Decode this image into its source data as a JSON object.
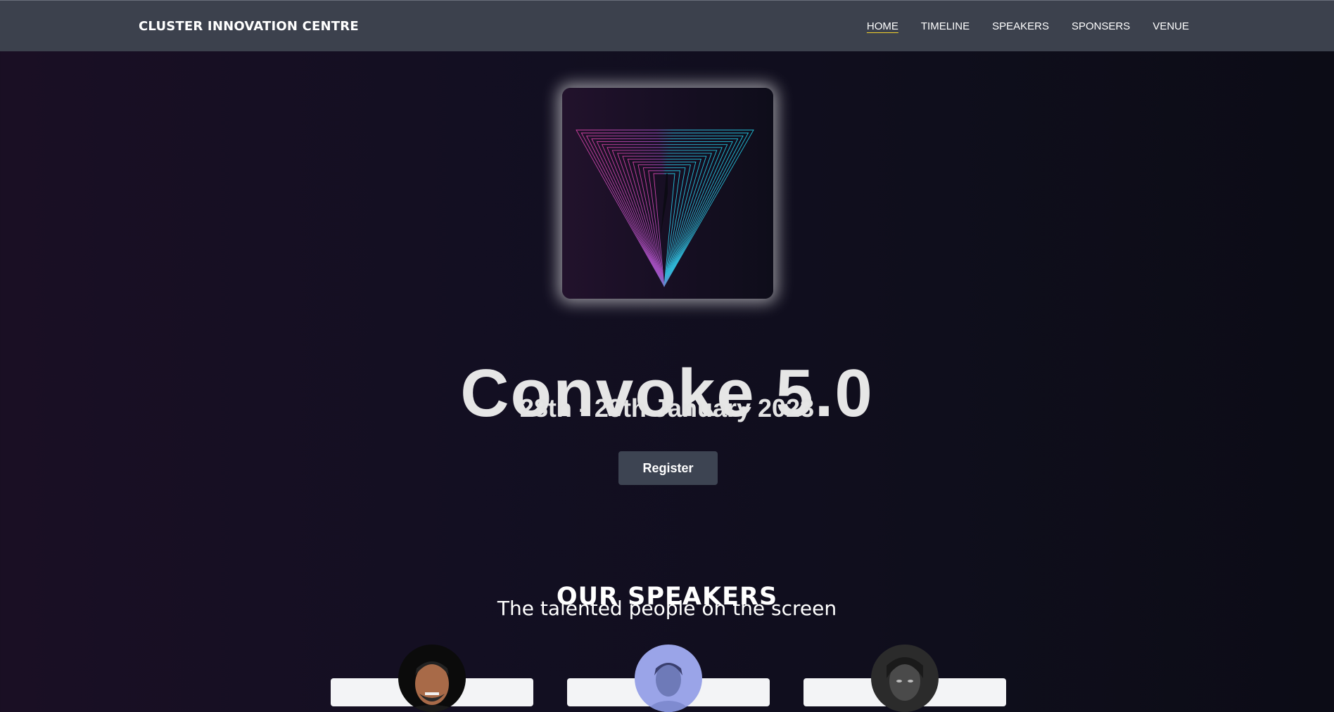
{
  "nav": {
    "brand": "CLUSTER INNOVATION CENTRE",
    "links": [
      "HOME",
      "TIMELINE",
      "SPEAKERS",
      "SPONSERS",
      "VENUE"
    ],
    "active": "HOME",
    "active_underline_color": "#f3d12a"
  },
  "hero": {
    "title": "Convoke 5.0",
    "date": "28th - 29th January 2023",
    "register_label": "Register"
  },
  "speakers": {
    "title": "OUR SPEAKERS",
    "subtitle": "The talented people on the screen",
    "cards": [
      {
        "avatar": "speaker-photo-1"
      },
      {
        "avatar": "speaker-photo-2"
      },
      {
        "avatar": "speaker-photo-3"
      }
    ]
  },
  "colors": {
    "navbar": "#3c414d",
    "button": "#3d4452",
    "logo_pink": "#d040a0",
    "logo_cyan": "#20c0d8"
  }
}
